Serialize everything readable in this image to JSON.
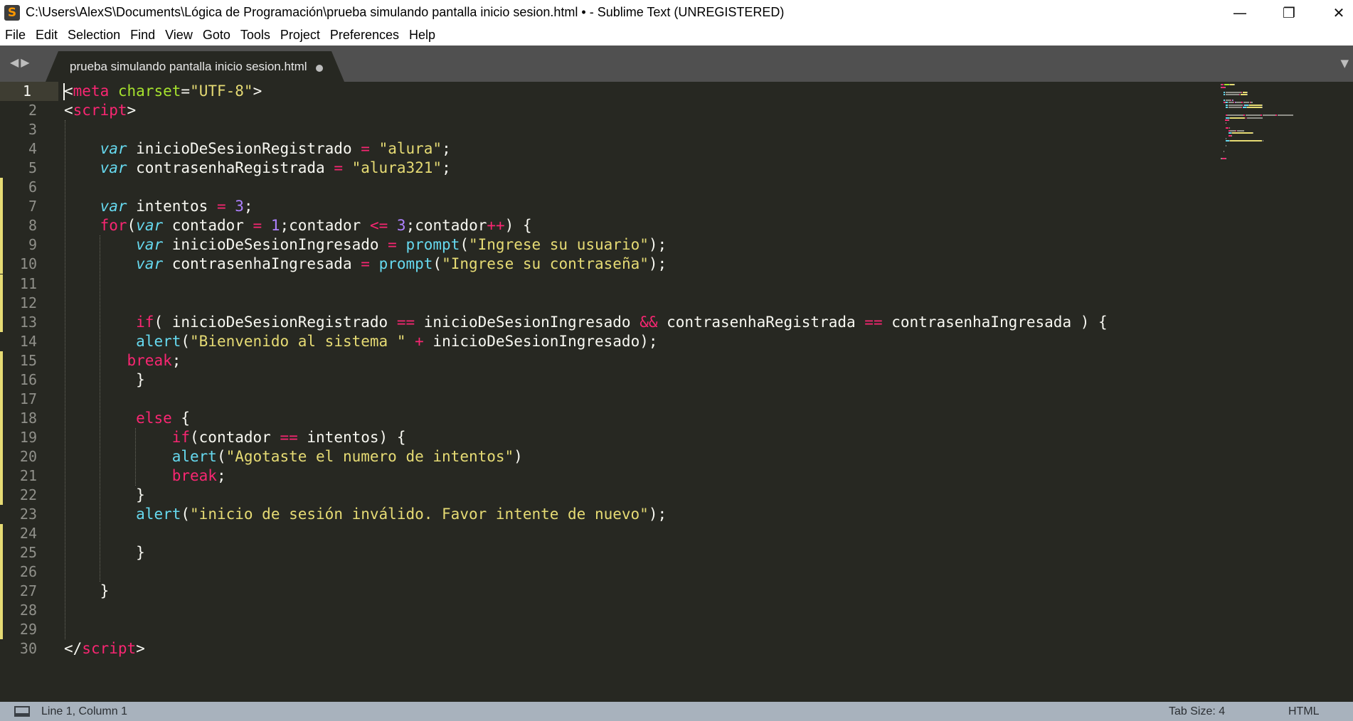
{
  "window": {
    "title": "C:\\Users\\AlexS\\Documents\\Lógica de Programación\\prueba simulando pantalla inicio sesion.html • - Sublime Text (UNREGISTERED)",
    "app_icon": "sublime-text-logo-icon",
    "controls": {
      "minimize": "—",
      "restore": "❐",
      "close": "✕"
    }
  },
  "menu": [
    "File",
    "Edit",
    "Selection",
    "Find",
    "View",
    "Goto",
    "Tools",
    "Project",
    "Preferences",
    "Help"
  ],
  "tab": {
    "title": "prueba simulando pantalla inicio sesion.html",
    "dirty": true
  },
  "colors": {
    "background": "#272822",
    "keyword": "#f92672",
    "storage": "#66d9ef",
    "string": "#e6db74",
    "number": "#ae81ff",
    "attribute": "#a6e22e",
    "modified_marker": "#e6db74"
  },
  "editor": {
    "active_line": 1,
    "modified_lines": [
      6,
      7,
      8,
      9,
      10,
      11,
      12,
      13,
      15,
      16,
      17,
      18,
      19,
      20,
      21,
      22,
      24,
      25,
      26,
      27,
      28,
      29
    ],
    "lines": [
      {
        "n": "1",
        "tokens": [
          [
            "<",
            ""
          ],
          [
            "meta",
            "tag"
          ],
          [
            " ",
            ""
          ],
          [
            "charset",
            "attr"
          ],
          [
            "=",
            ""
          ],
          [
            "\"UTF-8\"",
            "str"
          ],
          [
            ">",
            ""
          ]
        ]
      },
      {
        "n": "2",
        "tokens": [
          [
            "<",
            ""
          ],
          [
            "script",
            "tag"
          ],
          [
            ">",
            ""
          ]
        ]
      },
      {
        "n": "3",
        "tokens": []
      },
      {
        "n": "4",
        "tokens": [
          [
            "    ",
            ""
          ],
          [
            "var",
            "st"
          ],
          [
            " inicioDeSesionRegistrado ",
            ""
          ],
          [
            "=",
            "op"
          ],
          [
            " ",
            ""
          ],
          [
            "\"alura\"",
            "str"
          ],
          [
            ";",
            ""
          ]
        ]
      },
      {
        "n": "5",
        "tokens": [
          [
            "    ",
            ""
          ],
          [
            "var",
            "st"
          ],
          [
            " contrasenhaRegistrada ",
            ""
          ],
          [
            "=",
            "op"
          ],
          [
            " ",
            ""
          ],
          [
            "\"alura321\"",
            "str"
          ],
          [
            ";",
            ""
          ]
        ]
      },
      {
        "n": "6",
        "tokens": []
      },
      {
        "n": "7",
        "tokens": [
          [
            "    ",
            ""
          ],
          [
            "var",
            "st"
          ],
          [
            " intentos ",
            ""
          ],
          [
            "=",
            "op"
          ],
          [
            " ",
            ""
          ],
          [
            "3",
            "num"
          ],
          [
            ";",
            ""
          ]
        ]
      },
      {
        "n": "8",
        "tokens": [
          [
            "    ",
            ""
          ],
          [
            "for",
            "kw"
          ],
          [
            "(",
            ""
          ],
          [
            "var",
            "st"
          ],
          [
            " contador ",
            ""
          ],
          [
            "=",
            "op"
          ],
          [
            " ",
            ""
          ],
          [
            "1",
            "num"
          ],
          [
            ";contador ",
            ""
          ],
          [
            "<=",
            "op"
          ],
          [
            " ",
            ""
          ],
          [
            "3",
            "num"
          ],
          [
            ";contador",
            ""
          ],
          [
            "++",
            "op"
          ],
          [
            ") {",
            ""
          ]
        ]
      },
      {
        "n": "9",
        "tokens": [
          [
            "        ",
            ""
          ],
          [
            "var",
            "st"
          ],
          [
            " inicioDeSesionIngresado ",
            ""
          ],
          [
            "=",
            "op"
          ],
          [
            " ",
            ""
          ],
          [
            "prompt",
            "fn"
          ],
          [
            "(",
            ""
          ],
          [
            "\"Ingrese su usuario\"",
            "str"
          ],
          [
            ");",
            ""
          ]
        ]
      },
      {
        "n": "10",
        "tokens": [
          [
            "        ",
            ""
          ],
          [
            "var",
            "st"
          ],
          [
            " contrasenhaIngresada ",
            ""
          ],
          [
            "=",
            "op"
          ],
          [
            " ",
            ""
          ],
          [
            "prompt",
            "fn"
          ],
          [
            "(",
            ""
          ],
          [
            "\"Ingrese su contraseña\"",
            "str"
          ],
          [
            ");",
            ""
          ]
        ]
      },
      {
        "n": "11",
        "tokens": []
      },
      {
        "n": "12",
        "tokens": []
      },
      {
        "n": "13",
        "tokens": [
          [
            "        ",
            ""
          ],
          [
            "if",
            "kw"
          ],
          [
            "( inicioDeSesionRegistrado ",
            ""
          ],
          [
            "==",
            "op"
          ],
          [
            " inicioDeSesionIngresado ",
            ""
          ],
          [
            "&&",
            "op"
          ],
          [
            " contrasenhaRegistrada ",
            ""
          ],
          [
            "==",
            "op"
          ],
          [
            " contrasenhaIngresada ) {",
            ""
          ]
        ]
      },
      {
        "n": "14",
        "tokens": [
          [
            "        ",
            ""
          ],
          [
            "alert",
            "fn"
          ],
          [
            "(",
            ""
          ],
          [
            "\"Bienvenido al sistema \"",
            "str"
          ],
          [
            " ",
            ""
          ],
          [
            "+",
            "op"
          ],
          [
            " inicioDeSesionIngresado);",
            ""
          ]
        ]
      },
      {
        "n": "15",
        "tokens": [
          [
            "       ",
            ""
          ],
          [
            "break",
            "kw"
          ],
          [
            ";",
            ""
          ]
        ]
      },
      {
        "n": "16",
        "tokens": [
          [
            "        }",
            ""
          ]
        ]
      },
      {
        "n": "17",
        "tokens": []
      },
      {
        "n": "18",
        "tokens": [
          [
            "        ",
            ""
          ],
          [
            "else",
            "kw"
          ],
          [
            " {",
            ""
          ]
        ]
      },
      {
        "n": "19",
        "tokens": [
          [
            "            ",
            ""
          ],
          [
            "if",
            "kw"
          ],
          [
            "(contador ",
            ""
          ],
          [
            "==",
            "op"
          ],
          [
            " intentos) {",
            ""
          ]
        ]
      },
      {
        "n": "20",
        "tokens": [
          [
            "            ",
            ""
          ],
          [
            "alert",
            "fn"
          ],
          [
            "(",
            ""
          ],
          [
            "\"Agotaste el numero de intentos\"",
            "str"
          ],
          [
            ")",
            ""
          ]
        ]
      },
      {
        "n": "21",
        "tokens": [
          [
            "            ",
            ""
          ],
          [
            "break",
            "kw"
          ],
          [
            ";",
            ""
          ]
        ]
      },
      {
        "n": "22",
        "tokens": [
          [
            "        }",
            ""
          ]
        ]
      },
      {
        "n": "23",
        "tokens": [
          [
            "        ",
            ""
          ],
          [
            "alert",
            "fn"
          ],
          [
            "(",
            ""
          ],
          [
            "\"inicio de sesión inválido. Favor intente de nuevo\"",
            "str"
          ],
          [
            ");",
            ""
          ]
        ]
      },
      {
        "n": "24",
        "tokens": []
      },
      {
        "n": "25",
        "tokens": [
          [
            "        }",
            ""
          ]
        ]
      },
      {
        "n": "26",
        "tokens": []
      },
      {
        "n": "27",
        "tokens": [
          [
            "    }",
            ""
          ]
        ]
      },
      {
        "n": "28",
        "tokens": []
      },
      {
        "n": "29",
        "tokens": []
      },
      {
        "n": "30",
        "tokens": [
          [
            "</",
            ""
          ],
          [
            "script",
            "tag"
          ],
          [
            ">",
            ""
          ]
        ]
      }
    ]
  },
  "status": {
    "position": "Line 1, Column 1",
    "tab_size": "Tab Size: 4",
    "syntax": "HTML"
  }
}
